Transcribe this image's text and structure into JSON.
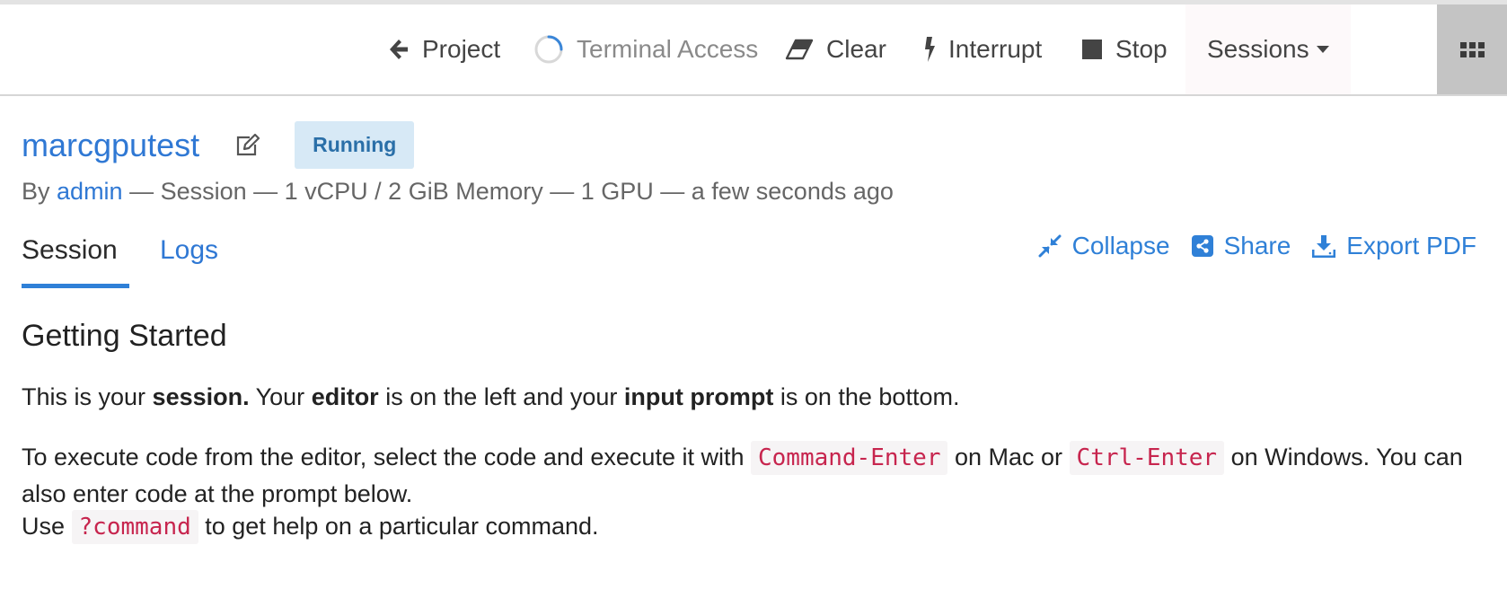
{
  "toolbar": {
    "project_label": "Project",
    "terminal_label": "Terminal Access",
    "clear_label": "Clear",
    "interrupt_label": "Interrupt",
    "stop_label": "Stop",
    "sessions_label": "Sessions"
  },
  "icons": {
    "project": "arrow-left-icon",
    "terminal": "spinner-icon",
    "clear": "eraser-icon",
    "interrupt": "bolt-icon",
    "stop": "stop-square-icon",
    "sessions": "caret-down-icon",
    "apps": "grid-icon",
    "edit": "edit-icon",
    "collapse": "compress-icon",
    "share": "share-icon",
    "export": "download-icon"
  },
  "colors": {
    "accent": "#2f78d4",
    "badge_bg": "#d7e9f6",
    "badge_text": "#2a6fa8",
    "code_text": "#c7254e"
  },
  "session": {
    "title": "marcgputest",
    "status": "Running",
    "meta_by": "By",
    "meta_user": "admin",
    "meta_details": "— Session — 1 vCPU / 2 GiB Memory — 1 GPU — a few seconds ago"
  },
  "tabs": {
    "session": "Session",
    "logs": "Logs"
  },
  "actions": {
    "collapse": "Collapse",
    "share": "Share",
    "export": "Export PDF"
  },
  "content": {
    "heading": "Getting Started",
    "p1_a": "This is your ",
    "p1_b": "session.",
    "p1_c": " Your ",
    "p1_d": "editor",
    "p1_e": " is on the left and your ",
    "p1_f": "input prompt",
    "p1_g": " is on the bottom.",
    "p2_a": "To execute code from the editor, select the code and execute it with ",
    "p2_code1": "Command-Enter",
    "p2_b": " on Mac or ",
    "p2_code2": "Ctrl-Enter",
    "p2_c": " on Windows. You can also enter code at the prompt below.",
    "p3_a": "Use ",
    "p3_code": "?command",
    "p3_b": " to get help on a particular command."
  }
}
